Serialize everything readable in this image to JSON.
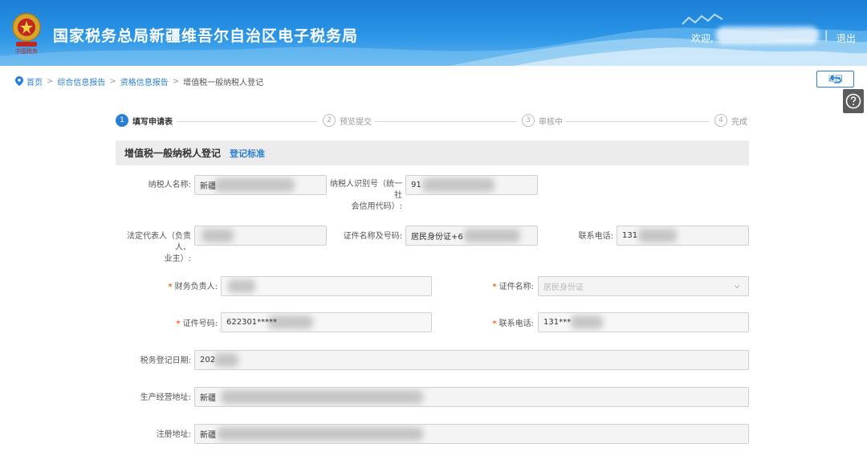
{
  "header": {
    "title": "国家税务总局新疆维吾尔自治区电子税务局",
    "welcome": "欢迎,",
    "divider": "|",
    "logout": "退出",
    "brand_color": "#2b95e6"
  },
  "breadcrumb": {
    "icon": "location-pin-icon",
    "items": [
      "首页",
      "综合信息报告",
      "资格信息报告"
    ],
    "current": "增值税一般纳税人登记",
    "separator": ">"
  },
  "toolbar": {
    "back_label": "返回",
    "back_icon": "return-arrow-icon",
    "help_icon": "question-circle-icon"
  },
  "steps": [
    {
      "num": "1",
      "label": "填写申请表",
      "state": "active"
    },
    {
      "num": "2",
      "label": "预览提交",
      "state": "pending"
    },
    {
      "num": "3",
      "label": "审核中",
      "state": "pending"
    },
    {
      "num": "4",
      "label": "完成",
      "state": "pending"
    }
  ],
  "section": {
    "title": "增值税一般纳税人登记",
    "link": "登记标准"
  },
  "form": {
    "taxpayer_name": {
      "label": "纳税人名称:",
      "value": "新疆"
    },
    "taxpayer_id": {
      "label_line1": "纳税人识别号（统一社",
      "label_line2": "会信用代码）:",
      "value": "91"
    },
    "legal_rep": {
      "label_line1": "法定代表人（负责人、",
      "label_line2": "业主）:",
      "value": ""
    },
    "cert_name_no": {
      "label": "证件名称及号码:",
      "value": "居民身份证+6"
    },
    "contact_phone": {
      "label": "联系电话:",
      "value": "131"
    },
    "finance_person": {
      "required": "*",
      "label": "财务负责人:",
      "value": ""
    },
    "cert_name": {
      "required": "*",
      "label": "证件名称:",
      "value": "居民身份证"
    },
    "cert_no": {
      "required": "*",
      "label": "证件号码:",
      "value": "622301*****"
    },
    "finance_phone": {
      "required": "*",
      "label": "联系电话:",
      "value": "131***"
    },
    "reg_date": {
      "label": "税务登记日期:",
      "value": "202"
    },
    "business_address": {
      "label": "生产经营地址:",
      "value": "新疆"
    },
    "registered_address": {
      "label": "注册地址:",
      "value": "新疆"
    }
  }
}
